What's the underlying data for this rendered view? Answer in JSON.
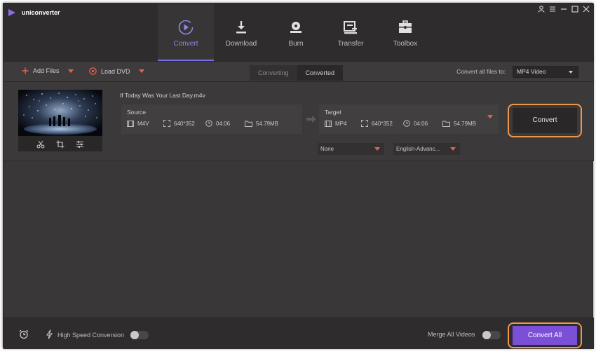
{
  "app": {
    "title": "uniconverter"
  },
  "nav": {
    "items": [
      {
        "label": "Convert",
        "icon": "convert-icon",
        "active": true
      },
      {
        "label": "Download",
        "icon": "download-icon",
        "active": false
      },
      {
        "label": "Burn",
        "icon": "burn-icon",
        "active": false
      },
      {
        "label": "Transfer",
        "icon": "transfer-icon",
        "active": false
      },
      {
        "label": "Toolbox",
        "icon": "toolbox-icon",
        "active": false
      }
    ]
  },
  "toolbar": {
    "add_files": "Add Files",
    "load_dvd": "Load DVD",
    "tabs": [
      "Converting",
      "Converted"
    ],
    "active_tab": "Converting",
    "convert_all_to_label": "Convert all files to:",
    "format_value": "MP4 Video"
  },
  "file": {
    "name": "If Today Was Your Last Day.m4v",
    "source": {
      "title": "Source",
      "format": "M4V",
      "resolution": "640*352",
      "duration": "04:06",
      "size": "54.79MB"
    },
    "target": {
      "title": "Target",
      "format": "MP4",
      "resolution": "640*352",
      "duration": "04:06",
      "size": "54.79MB"
    },
    "subtitle": "None",
    "audio": "English-Advanc...",
    "convert_label": "Convert"
  },
  "bottom": {
    "high_speed_label": "High Speed Conversion",
    "high_speed_on": false,
    "merge_label": "Merge All Videos",
    "merge_on": false,
    "convert_all_label": "Convert All"
  },
  "colors": {
    "accent_purple": "#7b4fd6",
    "highlight_orange": "#f0964a",
    "caret_red": "#e8604c"
  }
}
